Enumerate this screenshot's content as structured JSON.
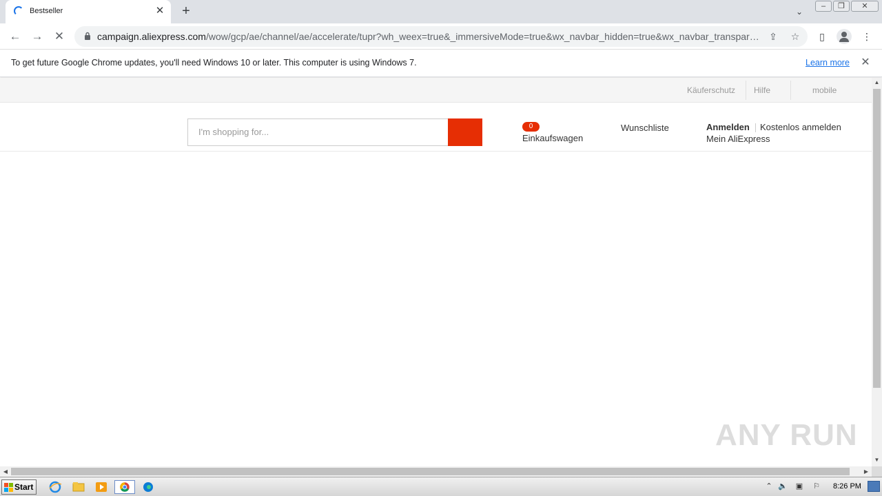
{
  "browser": {
    "tab_title": "Bestseller",
    "url_host": "campaign.aliexpress.com",
    "url_path": "/wow/gcp/ae/channel/ae/accelerate/tupr?wh_weex=true&_immersiveMode=true&wx_navbar_hidden=true&wx_navbar_transpar…"
  },
  "infobar": {
    "message": "To get future Google Chrome updates, you'll need Windows 10 or later. This computer is using Windows 7.",
    "learn_more": "Learn more"
  },
  "page": {
    "topbar": {
      "buyer_protection": "Käuferschutz",
      "help": "Hilfe",
      "mobile": "mobile"
    },
    "header": {
      "search_placeholder": "I'm shopping for...",
      "cart_count": "0",
      "cart_label": "Einkaufswagen",
      "wishlist": "Wunschliste",
      "sign_in": "Anmelden",
      "register": "Kostenlos anmelden",
      "my_account": "Mein AliExpress"
    }
  },
  "watermark": "ANY RUN",
  "taskbar": {
    "start_label": "Start",
    "clock": "8:26 PM"
  },
  "colors": {
    "accent": "#e62e04",
    "link": "#1a73e8"
  }
}
